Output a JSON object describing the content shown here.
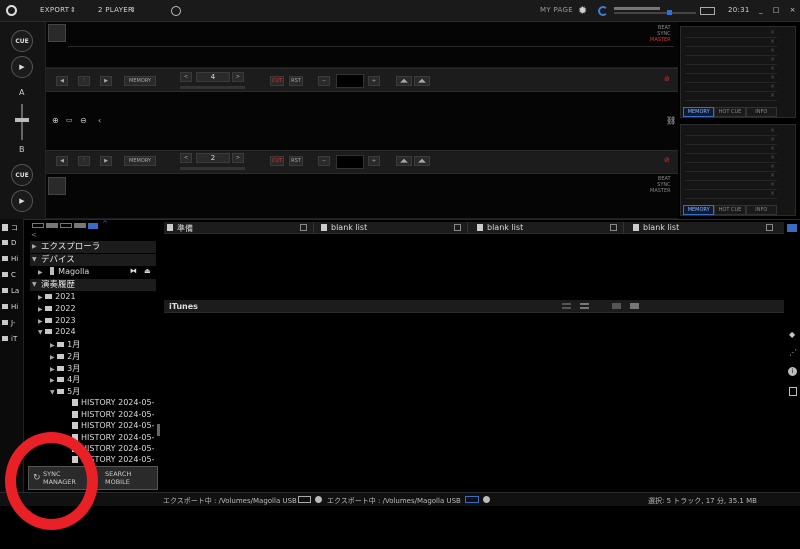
{
  "topbar": {
    "export_label": "EXPORT",
    "player_label": "2 PLAYER",
    "my_page": "MY PAGE",
    "time": "20:31",
    "window_controls": "_ □ ×"
  },
  "left_strip": {
    "cue_top": "CUE",
    "play_symbol": "▶",
    "deck_a": "A",
    "deck_b": "B",
    "cue_bottom": "CUE"
  },
  "deck1": {
    "memory_label": "MEMORY",
    "beat_jump_value": "4",
    "cut_label": "CUT",
    "rst_label": "RST",
    "beat_sync_master": [
      "BEAT",
      "SYNC",
      "MASTER"
    ]
  },
  "deck2": {
    "memory_label": "MEMORY",
    "beat_jump_value": "2",
    "cut_label": "CUT",
    "rst_label": "RST",
    "beat_sync_master": [
      "BEAT",
      "SYNC",
      "MASTER"
    ]
  },
  "right_panels": {
    "tabs": [
      "MEMORY",
      "HOT CUE",
      "INFO"
    ]
  },
  "browser_tree": {
    "headers": {
      "explorer": "エクスプローラ",
      "devices": "デバイス",
      "history": "演奏履歴"
    },
    "device_name": "Magolla",
    "years": [
      "2021",
      "2022",
      "2023",
      "2024"
    ],
    "months": [
      "1月",
      "2月",
      "3月",
      "4月",
      "5月"
    ],
    "histories": [
      "HISTORY 2024-05-",
      "HISTORY 2024-05-",
      "HISTORY 2024-05-",
      "HISTORY 2024-05-",
      "HISTORY 2024-05-",
      "HISTORY 2024-05-"
    ]
  },
  "left_nav": [
    "D",
    "Hi",
    "C",
    "La",
    "Hi",
    "J-",
    "iT"
  ],
  "left_nav_top": "コ",
  "playlist_headers": [
    "準備",
    "blank list",
    "blank list",
    "blank list"
  ],
  "itunes_label": "iTunes",
  "sync_button": {
    "line1": "SYNC",
    "line2": "MANAGER"
  },
  "search_button": {
    "line1": "SEARCH",
    "line2": "MOBILE"
  },
  "status": {
    "export1": "エクスポート中 : /Volumes/Magolla USB",
    "export2": "エクスポート中 : /Volumes/Magolla USB",
    "selection": "選択: 5 トラック, 17 分, 35.1 MB"
  },
  "colors": {
    "accent": "#3b6cc4",
    "red_ring": "#ea2027",
    "master_red": "#e03030"
  }
}
